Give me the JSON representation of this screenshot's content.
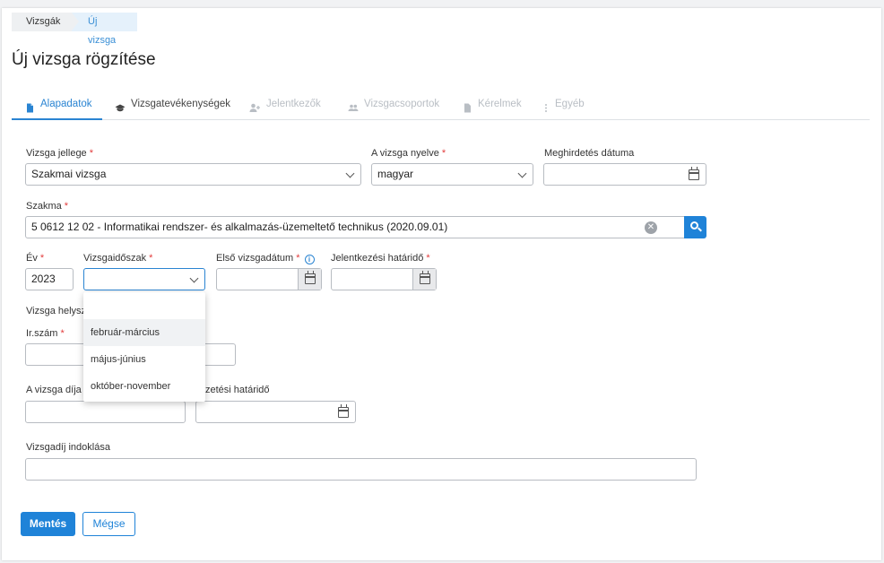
{
  "breadcrumb": {
    "item1": "Vizsgák",
    "item2": "Új vizsga"
  },
  "page_title": "Új vizsga rögzítése",
  "tabs": [
    {
      "label": "Alapadatok",
      "icon": "document-icon"
    },
    {
      "label": "Vizsgatevékenységek",
      "icon": "graduation-cap-icon"
    },
    {
      "label": "Jelentkezők",
      "icon": "person-add-icon"
    },
    {
      "label": "Vizsgacsoportok",
      "icon": "group-icon"
    },
    {
      "label": "Kérelmek",
      "icon": "document-icon"
    },
    {
      "label": "Egyéb",
      "icon": "more-vertical-icon"
    }
  ],
  "form": {
    "vizsga_jellege": {
      "label": "Vizsga jellege",
      "value": "Szakmai vizsga"
    },
    "vizsga_nyelve": {
      "label": "A vizsga nyelve",
      "value": "magyar"
    },
    "meghirdetes": {
      "label": "Meghirdetés dátuma",
      "value": ""
    },
    "szakma": {
      "label": "Szakma",
      "value": "5 0612 12 02 - Informatikai rendszer- és alkalmazás-üzemeltető technikus (2020.09.01)"
    },
    "ev": {
      "label": "Év",
      "value": "2023"
    },
    "vizsgaidoszak": {
      "label": "Vizsgaidőszak",
      "value": ""
    },
    "elso_vizsgadatum": {
      "label": "Első vizsgadátum",
      "value": ""
    },
    "jelentkezesi_hatarido": {
      "label": "Jelentkezési határidő",
      "value": ""
    },
    "vizsga_helyszine": {
      "label": "Vizsga helysz"
    },
    "irszam": {
      "label": "Ir.szám",
      "value": ""
    },
    "vizsga_dija": {
      "label": "A vizsga díja",
      "value": ""
    },
    "fizetesi_hatarido": {
      "label": "zetési határidő",
      "value": ""
    },
    "vizsgadij_indoklasa": {
      "label": "Vizsgadíj indoklása",
      "value": ""
    }
  },
  "dropdown": {
    "options": [
      "",
      "február-március",
      "május-június",
      "október-november"
    ]
  },
  "buttons": {
    "save": "Mentés",
    "cancel": "Mégse"
  },
  "colors": {
    "accent": "#1f83d8",
    "required": "#e23c3c"
  }
}
